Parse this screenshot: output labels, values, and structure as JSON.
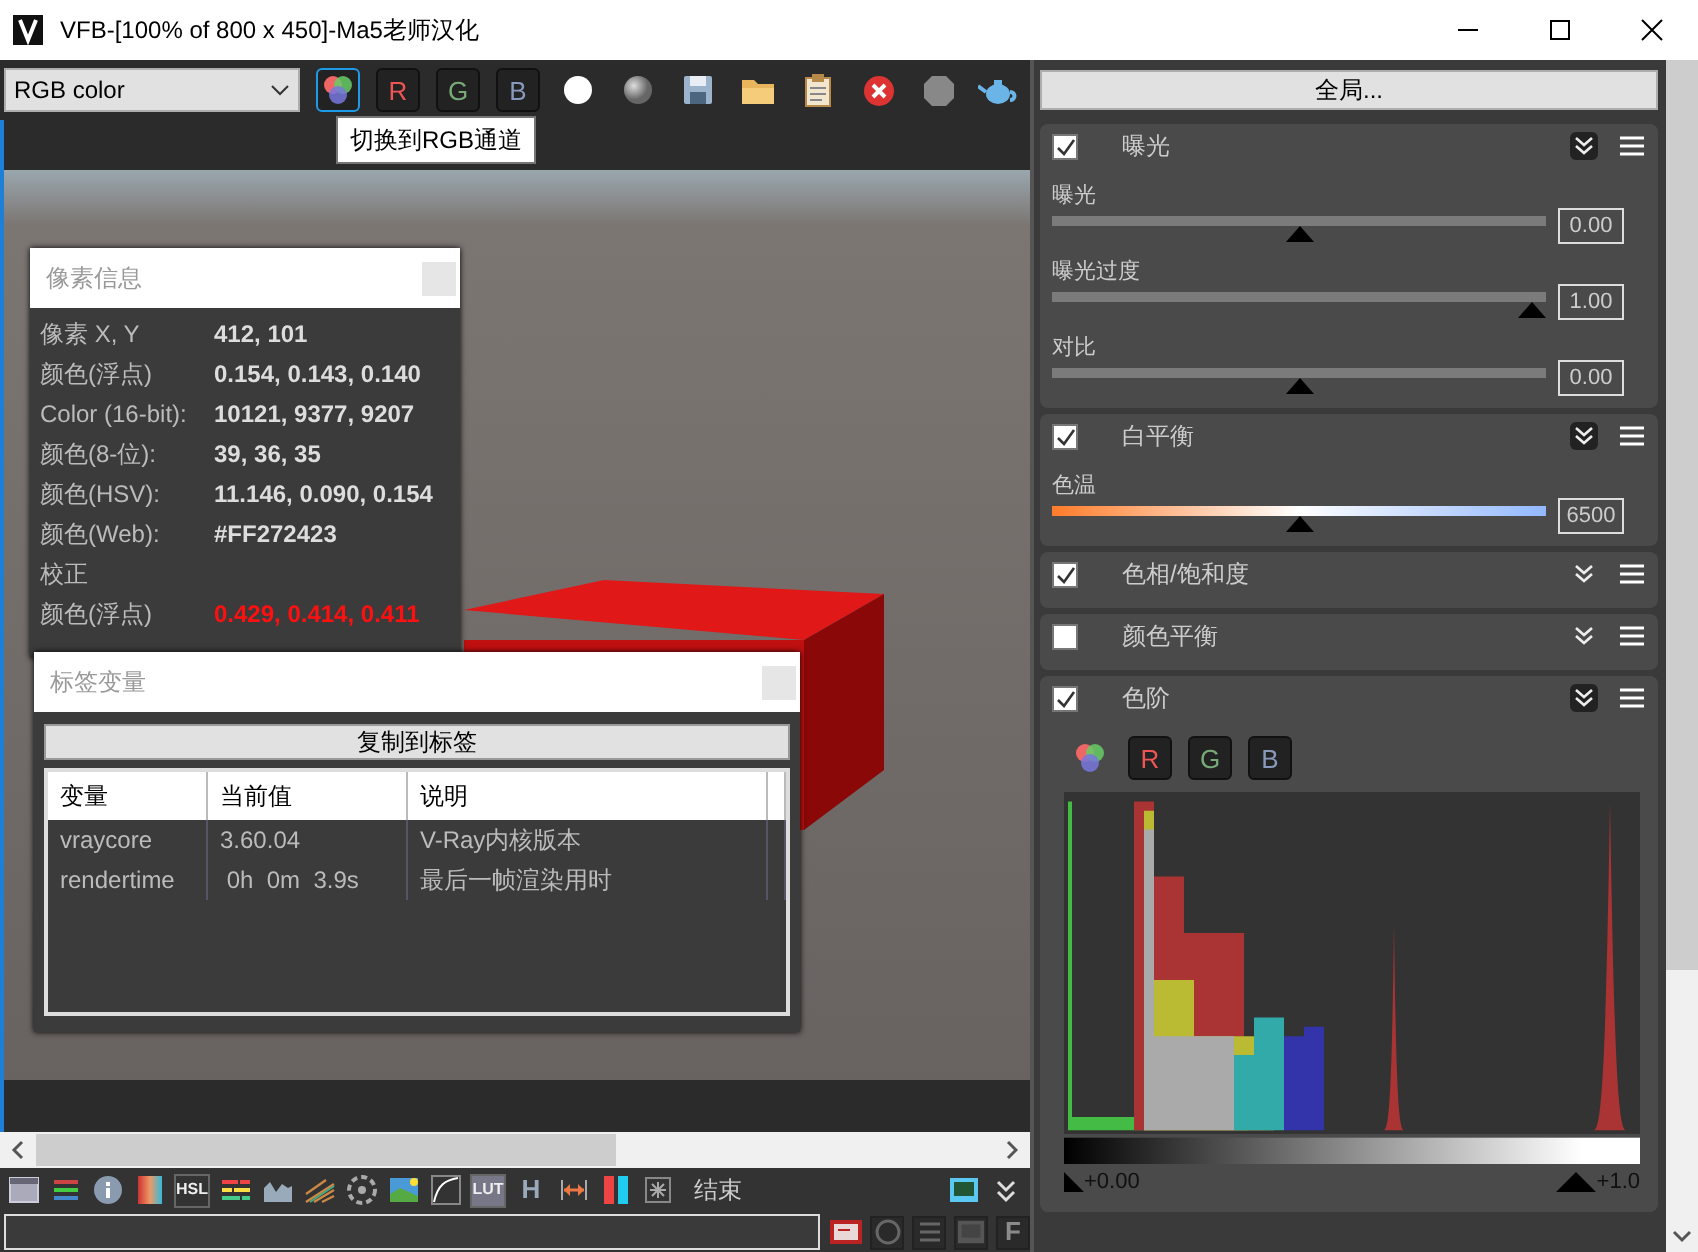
{
  "window": {
    "title": "VFB-[100% of 800 x 450]-Ma5老师汉化"
  },
  "toolbar": {
    "display_mode": "RGB color",
    "channel_buttons": [
      {
        "kind": "rgb",
        "selected": true
      },
      {
        "kind": "red",
        "label": "R",
        "selected": false
      },
      {
        "kind": "green",
        "label": "G",
        "selected": false
      },
      {
        "kind": "blue",
        "label": "B",
        "selected": false
      }
    ],
    "tools": [
      {
        "kind": "white-sphere"
      },
      {
        "kind": "gray-sphere"
      },
      {
        "kind": "save"
      },
      {
        "kind": "open"
      },
      {
        "kind": "clipboard"
      },
      {
        "kind": "clear"
      },
      {
        "kind": "stop"
      },
      {
        "kind": "teapot"
      }
    ],
    "global_button": "全局..."
  },
  "tooltip": "切换到RGB通道",
  "pixel_info": {
    "title": "像素信息",
    "rows": [
      {
        "kind": "value",
        "label": "像素 X, Y",
        "value": "412, 101"
      },
      {
        "kind": "value",
        "label": "颜色(浮点)",
        "value": "0.154, 0.143, 0.140"
      },
      {
        "kind": "value",
        "label": "Color (16-bit):",
        "value": "10121, 9377, 9207"
      },
      {
        "kind": "value",
        "label": "颜色(8-位):",
        "value": "39, 36, 35"
      },
      {
        "kind": "value",
        "label": "颜色(HSV):",
        "value": "11.146, 0.090, 0.154"
      },
      {
        "kind": "value",
        "label": "颜色(Web):",
        "value": "#FF272423"
      },
      {
        "kind": "section",
        "label": "校正"
      },
      {
        "kind": "corrected",
        "label": "颜色(浮点)",
        "value": "0.429, 0.414, 0.411"
      }
    ]
  },
  "tag_variables": {
    "title": "标签变量",
    "copy_button": "复制到标签",
    "columns": [
      "变量",
      "当前值",
      "说明"
    ],
    "rows": [
      [
        "vraycore",
        "3.60.04",
        "V-Ray内核版本"
      ],
      [
        "rendertime",
        " 0h  0m  3.9s",
        "最后一帧渲染用时"
      ]
    ]
  },
  "corrections": [
    {
      "title": "曝光",
      "checked": true,
      "expanded": true,
      "sliders": [
        {
          "label": "曝光",
          "kind": "plain",
          "level": 0.5,
          "value": "0.00"
        },
        {
          "label": "曝光过度",
          "kind": "plain",
          "level": 1,
          "value": "1.00"
        },
        {
          "label": "对比",
          "kind": "plain",
          "level": 0.5,
          "value": "0.00"
        }
      ]
    },
    {
      "title": "白平衡",
      "checked": true,
      "expanded": true,
      "sliders": [
        {
          "label": "色温",
          "kind": "temperature",
          "level": 0.5,
          "value": "6500"
        }
      ]
    },
    {
      "title": "色相/饱和度",
      "checked": true,
      "expanded": false
    },
    {
      "title": "颜色平衡",
      "checked": false,
      "expanded": false
    },
    {
      "title": "色阶",
      "checked": true,
      "expanded": true,
      "levels": {
        "channels": [
          {
            "kind": "rgb"
          },
          {
            "kind": "red",
            "label": "R"
          },
          {
            "kind": "green",
            "label": "G"
          },
          {
            "kind": "blue",
            "label": "B"
          }
        ],
        "min_label": "+0.00",
        "max_label": "+1.0"
      }
    }
  ],
  "bottom_toolbar": {
    "tools": [
      {
        "kind": "window"
      },
      {
        "kind": "layers"
      },
      {
        "kind": "info"
      },
      {
        "kind": "gradient"
      },
      {
        "kind": "hsl",
        "label": "HSL"
      },
      {
        "kind": "bars"
      },
      {
        "kind": "histogram"
      },
      {
        "kind": "lines"
      },
      {
        "kind": "wheel"
      },
      {
        "kind": "image"
      },
      {
        "kind": "curve"
      },
      {
        "kind": "lut",
        "label": "LUT"
      },
      {
        "kind": "letter",
        "label": "H"
      },
      {
        "kind": "span"
      },
      {
        "kind": "split"
      },
      {
        "kind": "grid"
      }
    ],
    "end_label": "结束",
    "right_tools": [
      {
        "kind": "monitor"
      },
      {
        "kind": "chevrons"
      }
    ]
  },
  "status_row": {
    "buttons": [
      {
        "kind": "flag",
        "disabled": false
      },
      {
        "kind": "circle",
        "disabled": true
      },
      {
        "kind": "list",
        "disabled": true
      },
      {
        "kind": "monitor",
        "disabled": true
      },
      {
        "kind": "letter",
        "label": "F",
        "disabled": true
      }
    ]
  }
}
